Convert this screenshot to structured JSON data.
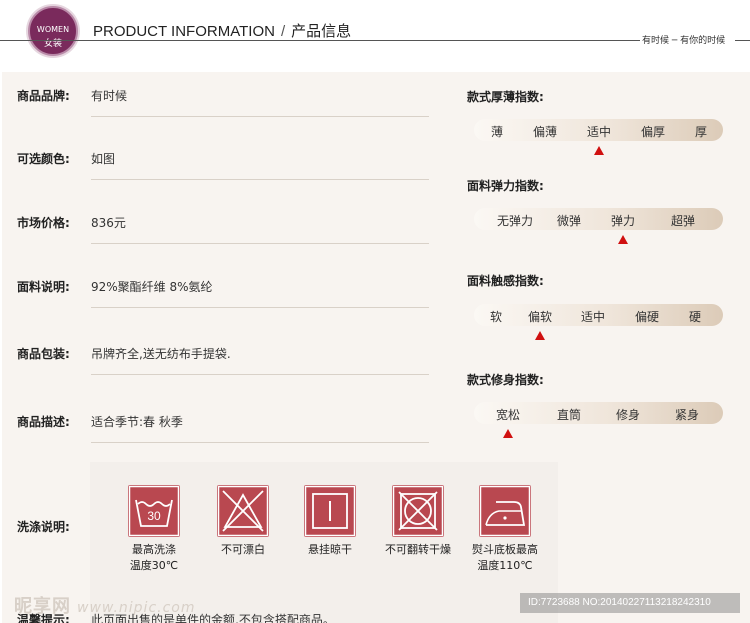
{
  "header": {
    "badge_en": "WOMEN",
    "badge_cn": "女装",
    "title_en": "PRODUCT INFORMATION",
    "separator": "/",
    "title_cn": "产品信息",
    "tagline": "有时候 ─ 有你的时候"
  },
  "details": [
    {
      "label": "商品品牌:",
      "value": "有时候"
    },
    {
      "label": "可选颜色:",
      "value": "如图"
    },
    {
      "label": "市场价格:",
      "value": "836元"
    },
    {
      "label": "面料说明:",
      "value": "92%聚酯纤维 8%氨纶"
    },
    {
      "label": "商品包装:",
      "value": "吊牌齐全,送无纺布手提袋."
    },
    {
      "label": "商品描述:",
      "value": "适合季节:春 秋季"
    }
  ],
  "indices": [
    {
      "title": "款式厚薄指数:",
      "options": [
        "薄",
        "偏薄",
        "适中",
        "偏厚",
        "厚"
      ],
      "selected_index": 2
    },
    {
      "title": "面料弹力指数:",
      "options": [
        "无弹力",
        "微弹",
        "弹力",
        "超弹"
      ],
      "selected_index": 2
    },
    {
      "title": "面料触感指数:",
      "options": [
        "软",
        "偏软",
        "适中",
        "偏硬",
        "硬"
      ],
      "selected_index": 1
    },
    {
      "title": "款式修身指数:",
      "options": [
        "宽松",
        "直筒",
        "修身",
        "紧身"
      ],
      "selected_index": 0
    }
  ],
  "care": {
    "label": "洗涤说明:",
    "items": [
      {
        "icon": "wash-30-icon",
        "text": "最高洗涤\n温度30℃",
        "number": "30"
      },
      {
        "icon": "no-bleach-icon",
        "text": "不可漂白"
      },
      {
        "icon": "line-dry-icon",
        "text": "悬挂晾干"
      },
      {
        "icon": "no-tumble-dry-icon",
        "text": "不可翻转干燥"
      },
      {
        "icon": "iron-110-icon",
        "text": "熨斗底板最高\n温度110℃"
      }
    ]
  },
  "tips": {
    "label": "温馨提示:",
    "value": "此页面出售的是单件的金额,不包含搭配商品。"
  },
  "watermark": {
    "site": "昵享网",
    "url": "www.nipic.com",
    "id_text": "ID:7723688 NO:20140227113218242310"
  },
  "colors": {
    "badge": "#7a2a5c",
    "care_icon": "#b94850",
    "indicator": "#d01010",
    "panel": "#f8f4f0"
  }
}
